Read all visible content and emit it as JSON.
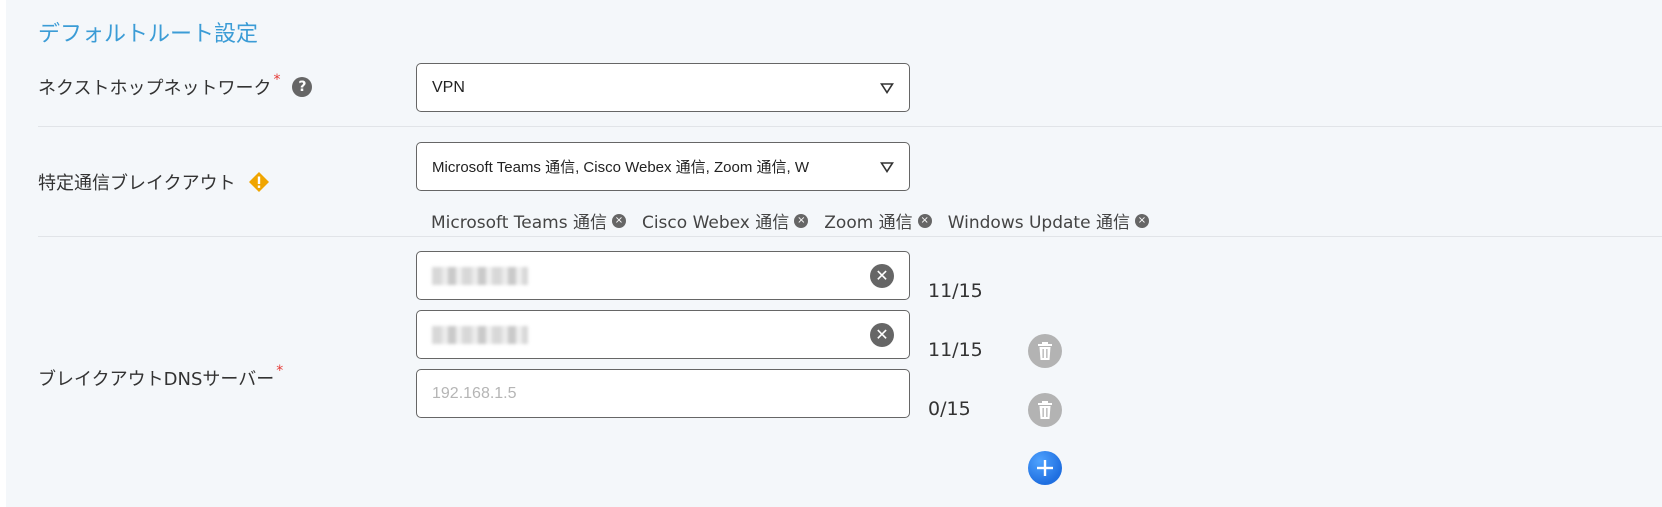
{
  "section": {
    "title": "デフォルトルート設定"
  },
  "next_hop": {
    "label": "ネクストホップネットワーク",
    "required_mark": "*",
    "help_icon": "question-circle-icon",
    "select_value": "VPN"
  },
  "breakout": {
    "label": "特定通信ブレイクアウト",
    "warn_icon": "warning-diamond-icon",
    "select_value": "Microsoft Teams 通信, Cisco Webex 通信, Zoom 通信, W",
    "chips": [
      "Microsoft Teams 通信",
      "Cisco Webex 通信",
      "Zoom 通信",
      "Windows Update 通信"
    ]
  },
  "dns": {
    "label": "ブレイクアウトDNSサーバー",
    "required_mark": "*",
    "fields": [
      {
        "value": "",
        "masked": true,
        "counter": "11/15",
        "deletable": false
      },
      {
        "value": "",
        "masked": true,
        "counter": "11/15",
        "deletable": true
      },
      {
        "value": "",
        "placeholder": "192.168.1.5",
        "counter": "0/15",
        "deletable": true
      }
    ],
    "add_icon": "plus-circle-icon",
    "delete_icon": "trash-icon",
    "clear_icon": "close-circle-icon"
  },
  "colors": {
    "title": "#3b9cd6",
    "required": "#e53935",
    "warn": "#f0a500",
    "add_button": "#1f6fe0",
    "panel_bg": "#f4f7fa"
  }
}
